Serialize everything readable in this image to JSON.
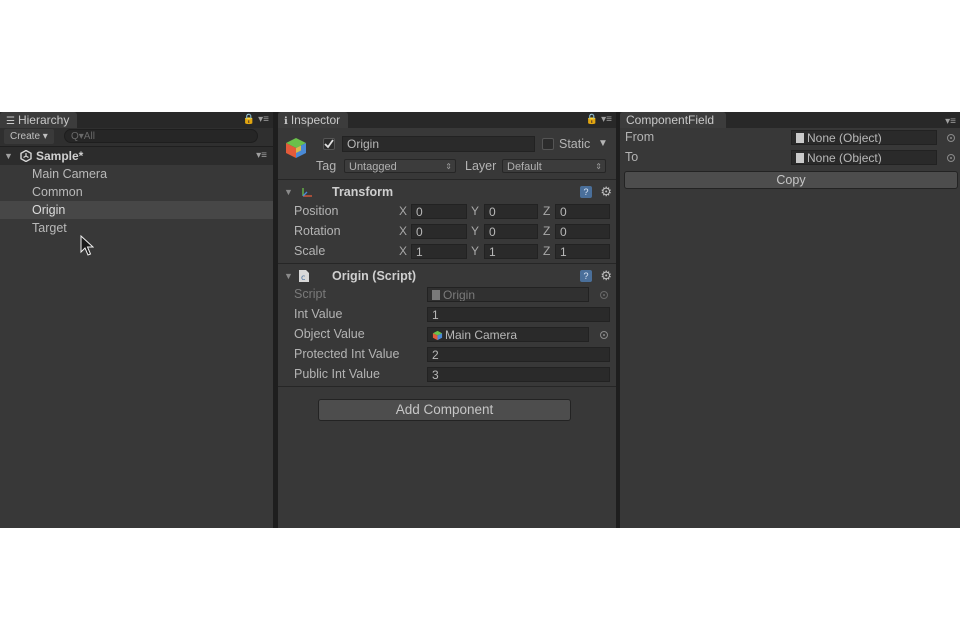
{
  "hierarchy": {
    "tab_label": "Hierarchy",
    "create_label": "Create ▾",
    "search_placeholder": "Q▾All",
    "scene_name": "Sample*",
    "items": [
      {
        "label": "Main Camera",
        "selected": false
      },
      {
        "label": "Common",
        "selected": false
      },
      {
        "label": "Origin",
        "selected": true
      },
      {
        "label": "Target",
        "selected": false
      }
    ]
  },
  "inspector": {
    "tab_label": "Inspector",
    "object_name": "Origin",
    "active": true,
    "static_label": "Static",
    "tag_label": "Tag",
    "tag_value": "Untagged",
    "layer_label": "Layer",
    "layer_value": "Default",
    "transform": {
      "title": "Transform",
      "position_label": "Position",
      "rotation_label": "Rotation",
      "scale_label": "Scale",
      "x_label": "X",
      "y_label": "Y",
      "z_label": "Z",
      "position": [
        "0",
        "0",
        "0"
      ],
      "rotation": [
        "0",
        "0",
        "0"
      ],
      "scale": [
        "1",
        "1",
        "1"
      ]
    },
    "script_component": {
      "title": "Origin (Script)",
      "script_label": "Script",
      "script_value": "Origin",
      "int_value_label": "Int Value",
      "int_value": "1",
      "object_value_label": "Object Value",
      "object_value": "Main Camera",
      "protected_int_label": "Protected Int Value",
      "protected_int_value": "2",
      "public_int_label": "Public Int Value",
      "public_int_value": "3"
    },
    "add_component_label": "Add Component"
  },
  "component_field": {
    "tab_label": "ComponentField",
    "from_label": "From",
    "from_value": "None (Object)",
    "to_label": "To",
    "to_value": "None (Object)",
    "copy_label": "Copy"
  },
  "colors": {
    "panel_bg": "#383838",
    "selection": "#474747",
    "help_icon": "#4a6f9a"
  }
}
